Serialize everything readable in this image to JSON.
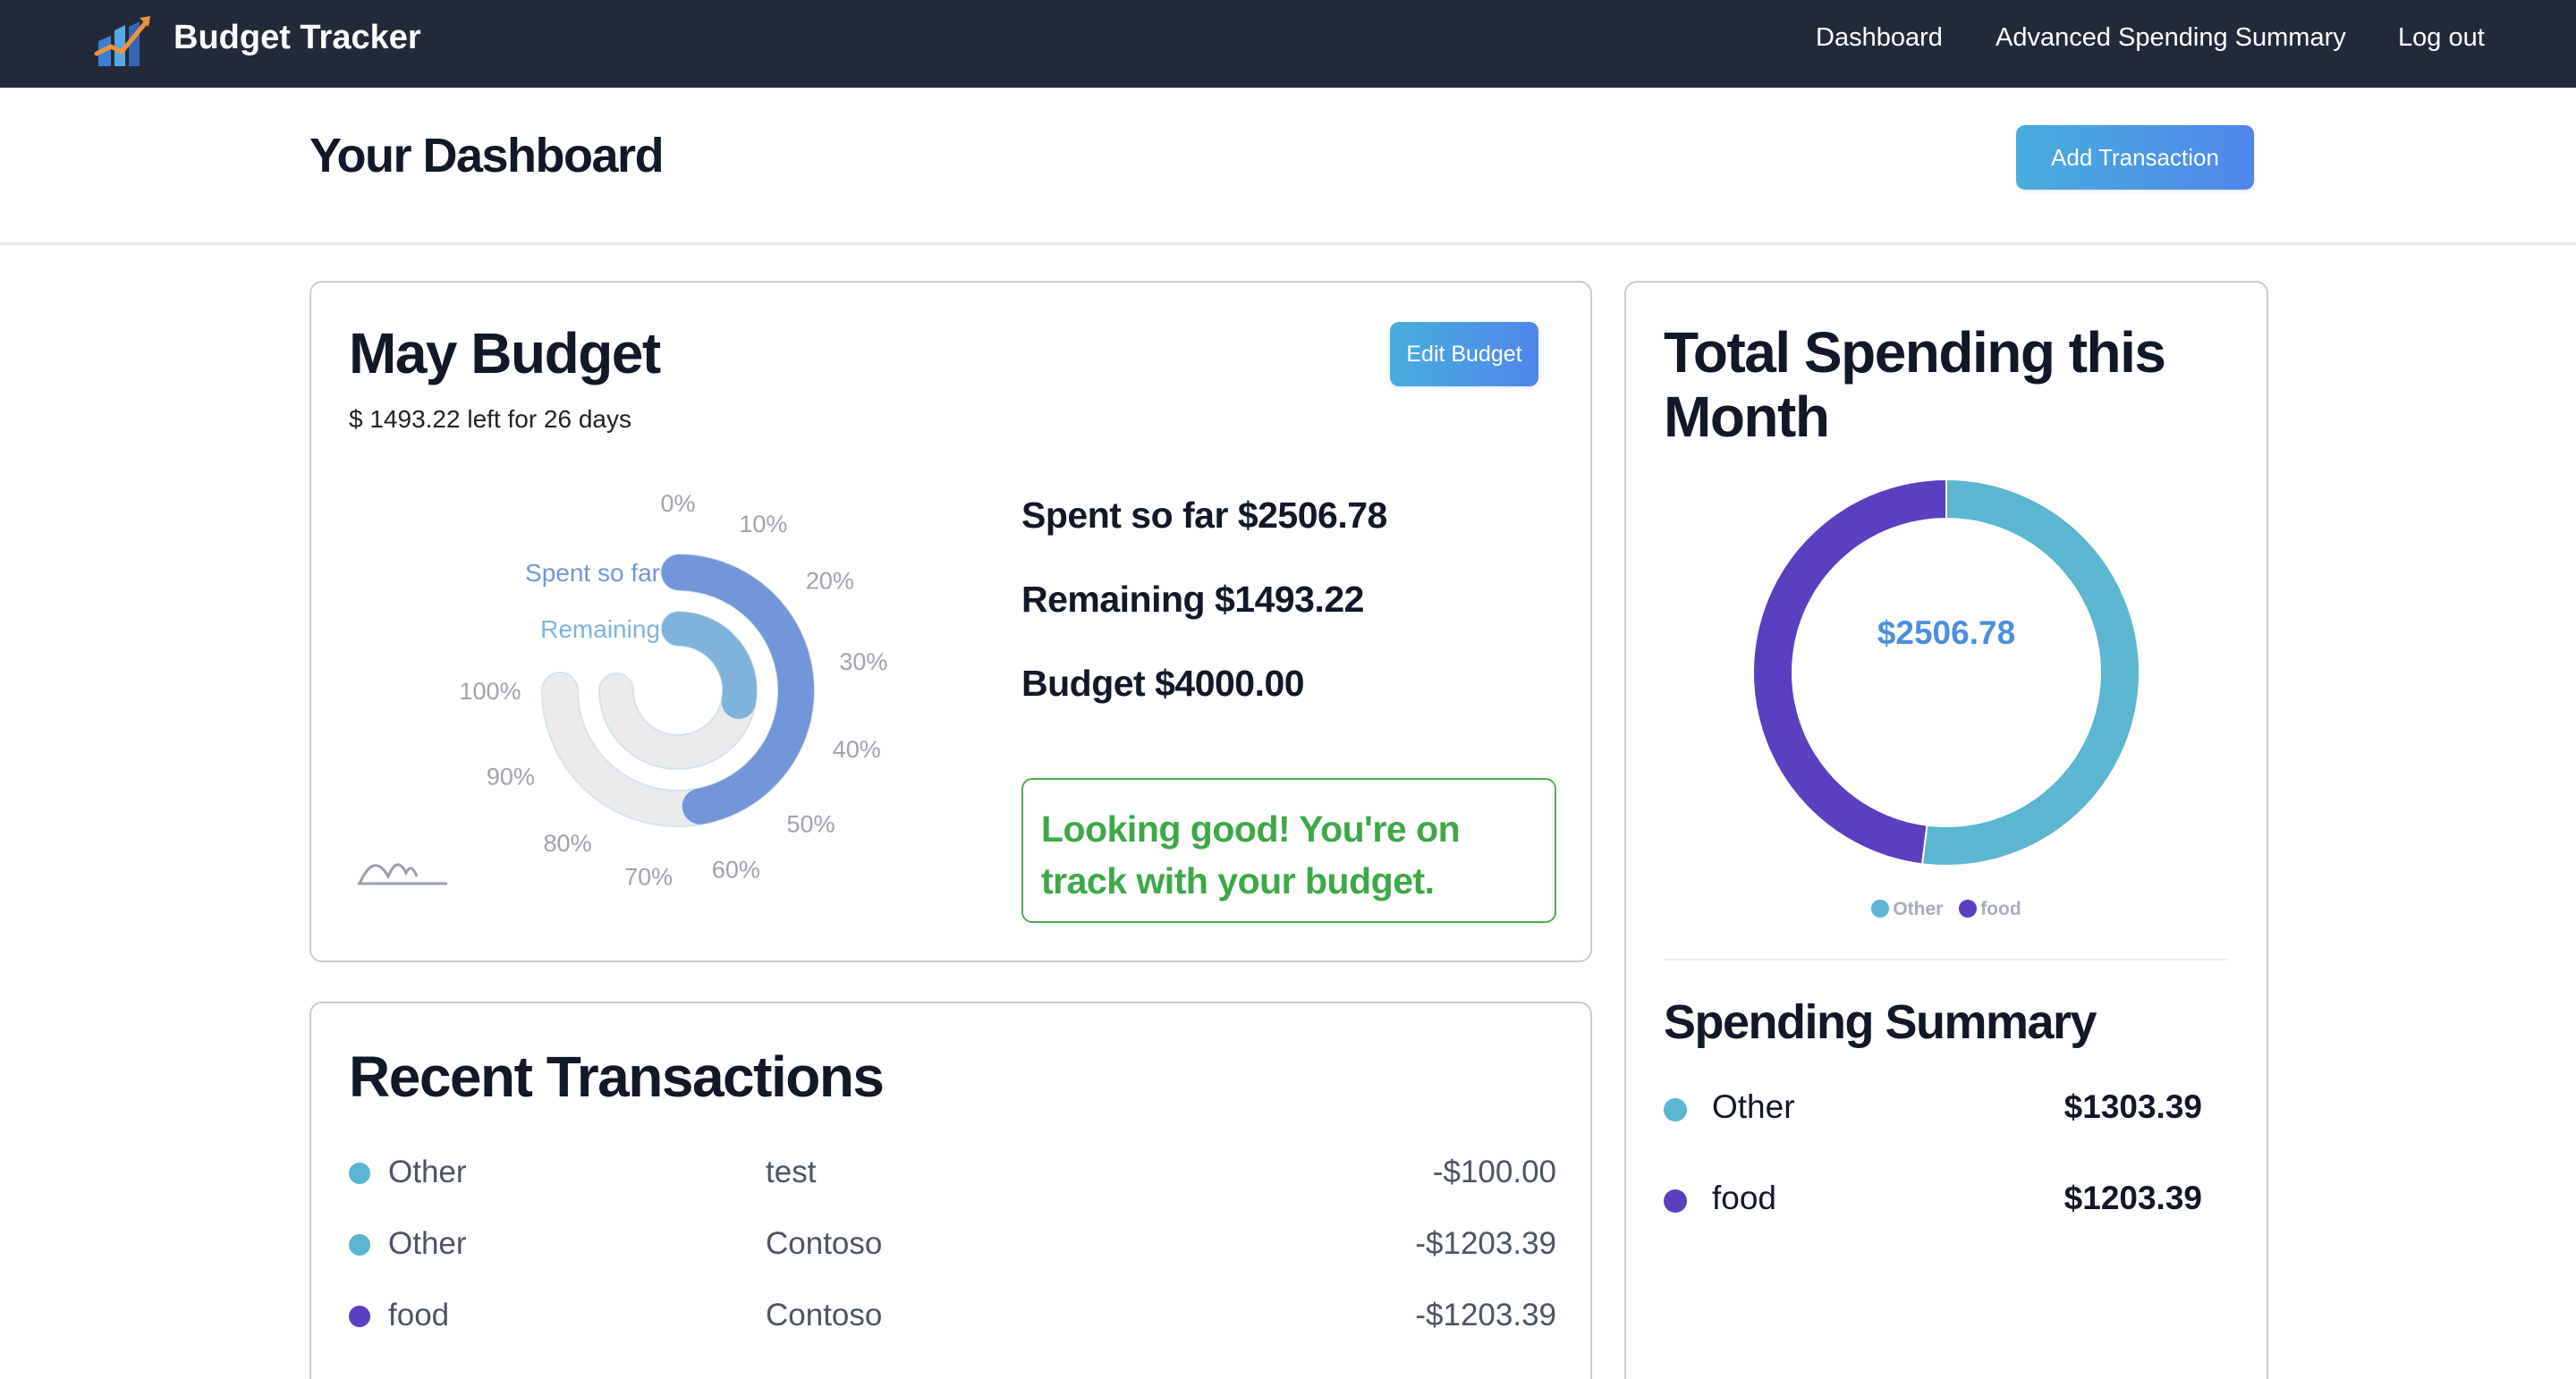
{
  "navbar": {
    "brand": "Budget Tracker",
    "links": [
      "Dashboard",
      "Advanced Spending Summary",
      "Log out"
    ]
  },
  "header": {
    "title": "Your Dashboard",
    "add_button": "Add Transaction"
  },
  "budget": {
    "title": "May Budget",
    "subtitle": "$ 1493.22 left for 26 days",
    "edit_button": "Edit Budget",
    "stats": [
      "Spent so far $2506.78",
      "Remaining $1493.22",
      "Budget $4000.00"
    ],
    "message": "Looking good! You're on track with your budget."
  },
  "chart_data": [
    {
      "type": "radial-bar",
      "series": [
        {
          "name": "Spent so far",
          "value": 62.67
        },
        {
          "name": "Remaining",
          "value": 37.33
        }
      ],
      "angular_axis": {
        "range": [
          0,
          100
        ],
        "ticks": [
          "0%",
          "10%",
          "20%",
          "30%",
          "40%",
          "50%",
          "60%",
          "70%",
          "80%",
          "90%",
          "100%"
        ]
      },
      "colors": {
        "Spent so far": "#7395d9",
        "Remaining": "#7fb3db",
        "track": "#ebebeb"
      }
    },
    {
      "type": "pie",
      "title": "Total Spending this Month",
      "center_label": "$2506.78",
      "categories": [
        "Other",
        "food"
      ],
      "values": [
        1303.39,
        1203.39
      ],
      "colors": [
        "#5ab6d1",
        "#5a3fc0"
      ],
      "legend": "bottom"
    }
  ],
  "transactions": {
    "title": "Recent Transactions",
    "rows": [
      {
        "category": "Other",
        "description": "test",
        "amount": "-$100.00",
        "color": "#5ab6d1"
      },
      {
        "category": "Other",
        "description": "Contoso",
        "amount": "-$1203.39",
        "color": "#5ab6d1"
      },
      {
        "category": "food",
        "description": "Contoso",
        "amount": "-$1203.39",
        "color": "#5a3fc0"
      }
    ]
  },
  "total_spending": {
    "title": "Total Spending this Month",
    "total": "$2506.78",
    "legend": [
      {
        "label": "Other",
        "color": "#5ab6d1"
      },
      {
        "label": "food",
        "color": "#5a3fc0"
      }
    ]
  },
  "summary": {
    "title": "Spending Summary",
    "rows": [
      {
        "category": "Other",
        "amount": "$1303.39",
        "color": "#5ab6d1"
      },
      {
        "category": "food",
        "amount": "$1203.39",
        "color": "#5a3fc0"
      }
    ]
  }
}
